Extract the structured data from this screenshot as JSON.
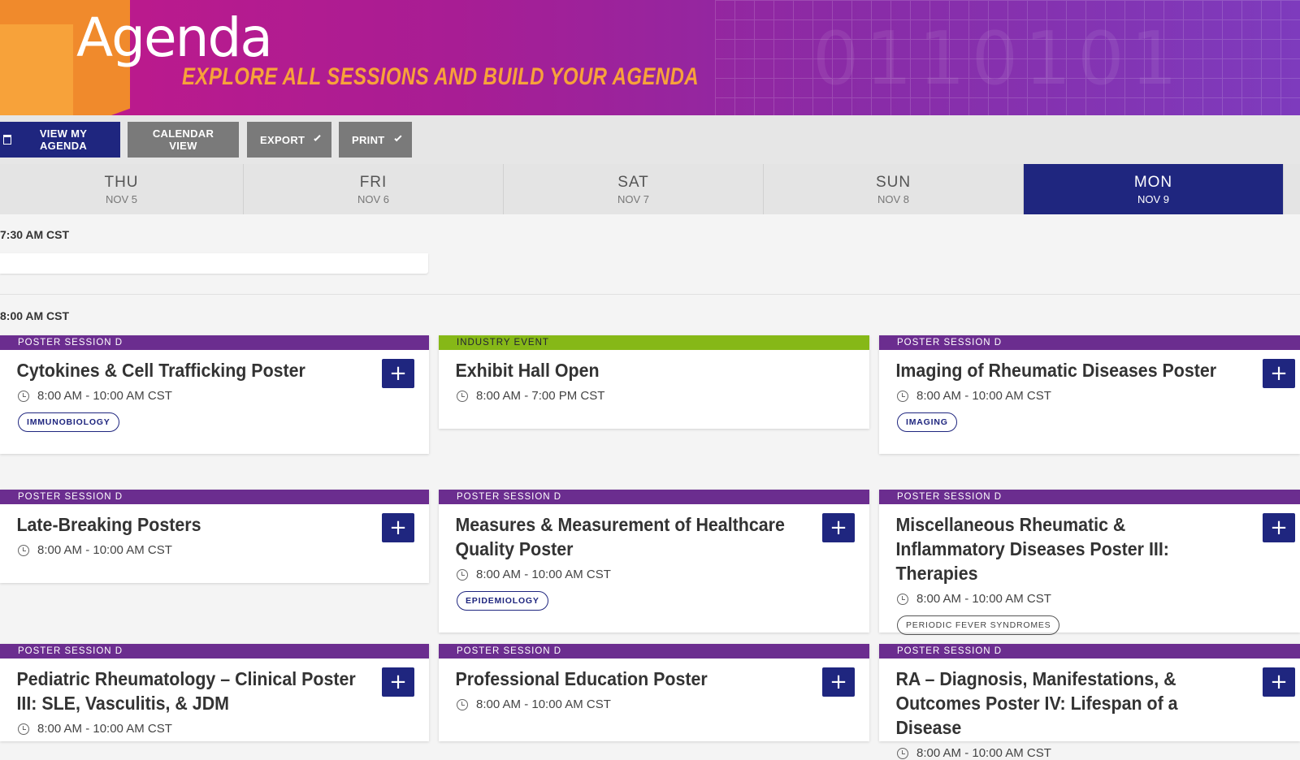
{
  "header": {
    "title": "Agenda",
    "subtitle": "EXPLORE ALL SESSIONS AND BUILD YOUR AGENDA",
    "bg_digits": "0110101"
  },
  "toolbar": {
    "view_my_agenda": "VIEW MY AGENDA",
    "calendar_view": "CALENDAR VIEW",
    "export": "EXPORT",
    "print": "PRINT"
  },
  "days": [
    {
      "name": "THU",
      "date": "NOV 5"
    },
    {
      "name": "FRI",
      "date": "NOV 6"
    },
    {
      "name": "SAT",
      "date": "NOV 7"
    },
    {
      "name": "SUN",
      "date": "NOV 8"
    },
    {
      "name": "MON",
      "date": "NOV 9"
    }
  ],
  "active_day": "MON",
  "time_slots": [
    "7:30 AM CST",
    "8:00 AM CST"
  ],
  "sessions": [
    {
      "category": "POSTER SESSION D",
      "title": "Cytokines & Cell Trafficking Poster",
      "time": "8:00 AM - 10:00 AM CST",
      "tag": "IMMUNOBIOLOGY"
    },
    {
      "category": "INDUSTRY EVENT",
      "title": "Exhibit Hall Open",
      "time": "8:00 AM - 7:00 PM CST"
    },
    {
      "category": "POSTER SESSION D",
      "title": "Imaging of Rheumatic Diseases Poster",
      "time": "8:00 AM - 10:00 AM CST",
      "tag": "IMAGING"
    },
    {
      "category": "POSTER SESSION D",
      "title": "Late-Breaking Posters",
      "time": "8:00 AM - 10:00 AM CST"
    },
    {
      "category": "POSTER SESSION D",
      "title": "Measures & Measurement of Healthcare Quality Poster",
      "time": "8:00 AM - 10:00 AM CST",
      "tag": "EPIDEMIOLOGY"
    },
    {
      "category": "POSTER SESSION D",
      "title": "Miscellaneous Rheumatic & Inflammatory Diseases Poster III: Therapies",
      "time": "8:00 AM - 10:00 AM CST",
      "tag": "PERIODIC FEVER SYNDROMES"
    },
    {
      "category": "POSTER SESSION D",
      "title": "Pediatric Rheumatology – Clinical Poster III: SLE, Vasculitis, & JDM",
      "time": "8:00 AM - 10:00 AM CST"
    },
    {
      "category": "POSTER SESSION D",
      "title": "Professional Education Poster",
      "time": "8:00 AM - 10:00 AM CST"
    },
    {
      "category": "POSTER SESSION D",
      "title": "RA – Diagnosis, Manifestations, & Outcomes Poster IV: Lifespan of a Disease",
      "time": "8:00 AM - 10:00 AM CST"
    }
  ],
  "add_symbol": "+",
  "colors": {
    "navy": "#1f267f",
    "poster_band": "#6b2d8f",
    "industry_band": "#86b817",
    "banner_orange": "#f7a23a"
  }
}
